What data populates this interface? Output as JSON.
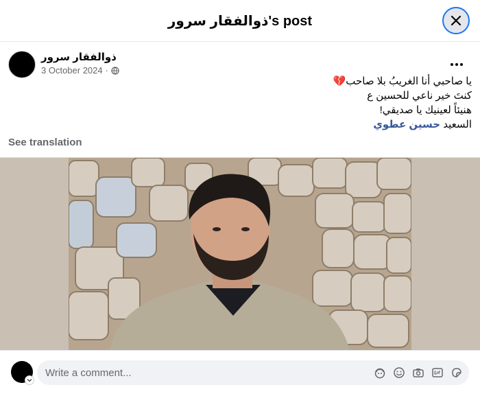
{
  "dialog": {
    "title": "ذوالفقار سرور's post"
  },
  "post": {
    "author": "ذوالفقار سرور",
    "date": "3 October 2024",
    "separator": "·",
    "privacy_icon": "globe-icon",
    "lines": [
      "يا صاحبي أنا الغريبُ بلا صاحب💔",
      "كنتَ خير ناعي للحسين ع",
      "هنيئاً لعينيك يا صديقي!"
    ],
    "last_line_prefix": "السعيد",
    "mention": "حسين عطوي",
    "see_translation": "See translation"
  },
  "composer": {
    "placeholder": "Write a comment...",
    "tools": [
      "avatar-sticker-icon",
      "emoji-icon",
      "camera-icon",
      "gif-icon",
      "sticker-icon"
    ]
  },
  "colors": {
    "accent": "#1877f2",
    "muted": "#65676b",
    "link": "#385898"
  }
}
